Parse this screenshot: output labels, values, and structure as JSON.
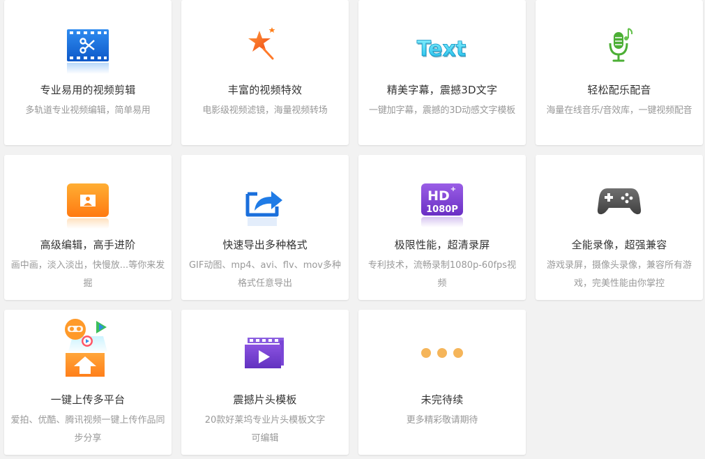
{
  "features": [
    {
      "title": "专业易用的视频剪辑",
      "desc": "多轨道专业视频编辑，简单易用",
      "icon": "video-scissors-icon"
    },
    {
      "title": "丰富的视频特效",
      "desc": "电影级视频滤镜，海量视频转场",
      "icon": "magic-star-icon"
    },
    {
      "title": "精美字幕，震撼3D文字",
      "desc": "一键加字幕，震撼的3D动感文字模板",
      "icon": "text-3d-icon"
    },
    {
      "title": "轻松配乐配音",
      "desc": "海量在线音乐/音效库，一键视频配音",
      "icon": "microphone-music-icon"
    },
    {
      "title": "高级编辑，高手进阶",
      "desc": "画中画，淡入淡出，快慢放...等你来发掘",
      "icon": "picture-in-picture-icon"
    },
    {
      "title": "快速导出多种格式",
      "desc": "GIF动图、mp4、avi、flv、mov多种格式任意导出",
      "icon": "export-share-icon"
    },
    {
      "title": "极限性能，超清录屏",
      "desc": "专利技术，流畅录制1080p-60fps视频",
      "icon": "hd-1080p-icon"
    },
    {
      "title": "全能录像，超强兼容",
      "desc": "游戏录屏，摄像头录像，兼容所有游戏，完美性能由你掌控",
      "icon": "gamepad-icon"
    },
    {
      "title": "一键上传多平台",
      "desc": "爱拍、优酷、腾讯视频一键上传作品同步分享",
      "icon": "upload-platforms-icon"
    },
    {
      "title": "震撼片头模板",
      "desc": "20款好莱坞专业片头模板文字可编辑",
      "icon": "clapperboard-play-icon"
    },
    {
      "title": "未完待续",
      "desc": "更多精彩敬请期待",
      "icon": "more-dots-icon"
    }
  ],
  "colors": {
    "background": "#f2f2f2",
    "card": "#ffffff",
    "title": "#333333",
    "desc": "#999999",
    "blue": "#1a6fdc",
    "orange": "#ff7f1a",
    "green": "#4caf35",
    "purple": "#7a3fd0",
    "gray": "#5a5a5a",
    "dots": "#f5b55a"
  }
}
